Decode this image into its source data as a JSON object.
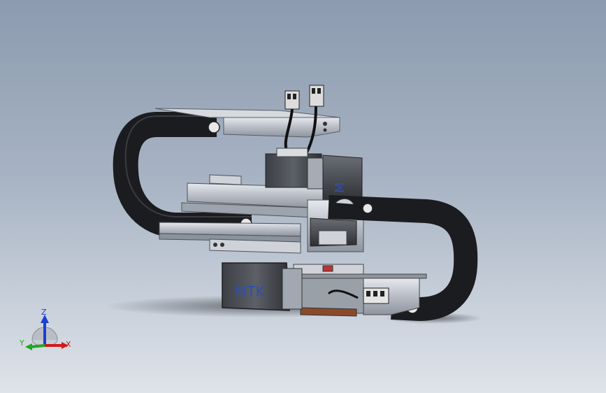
{
  "viewport": {
    "background_top": "#8c9bb0",
    "background_bottom": "#dfe3ea"
  },
  "model": {
    "motor_label_front": "MTK",
    "motor_label_side": "M"
  },
  "triad": {
    "x_label": "X",
    "y_label": "Y",
    "z_label": "Z",
    "x_color": "#d11a1a",
    "y_color": "#1fa81f",
    "z_color": "#1a3fd1"
  }
}
